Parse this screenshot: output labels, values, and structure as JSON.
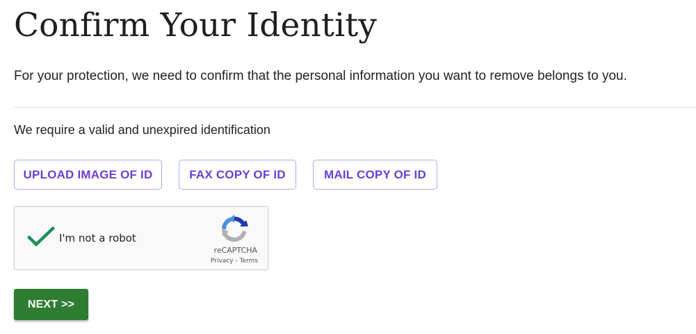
{
  "page": {
    "title": "Confirm Your Identity",
    "intro": "For your protection, we need to confirm that the personal information you want to remove belongs to you.",
    "requirement": "We require a valid and unexpired identification"
  },
  "id_options": {
    "upload_label": "UPLOAD IMAGE OF ID",
    "fax_label": "FAX COPY OF ID",
    "mail_label": "MAIL COPY OF ID"
  },
  "captcha": {
    "label": "I'm not a robot",
    "checked": true,
    "brand": "reCAPTCHA",
    "privacy_label": "Privacy",
    "separator": " - ",
    "terms_label": "Terms",
    "icons": [
      "checkmark-icon",
      "recaptcha-logo-icon"
    ]
  },
  "actions": {
    "next_label": "NEXT >>"
  },
  "colors": {
    "accent_purple": "#6a3fd6",
    "button_border": "#b7a5e8",
    "next_green": "#2e7d32",
    "check_green": "#1e8e5a"
  }
}
